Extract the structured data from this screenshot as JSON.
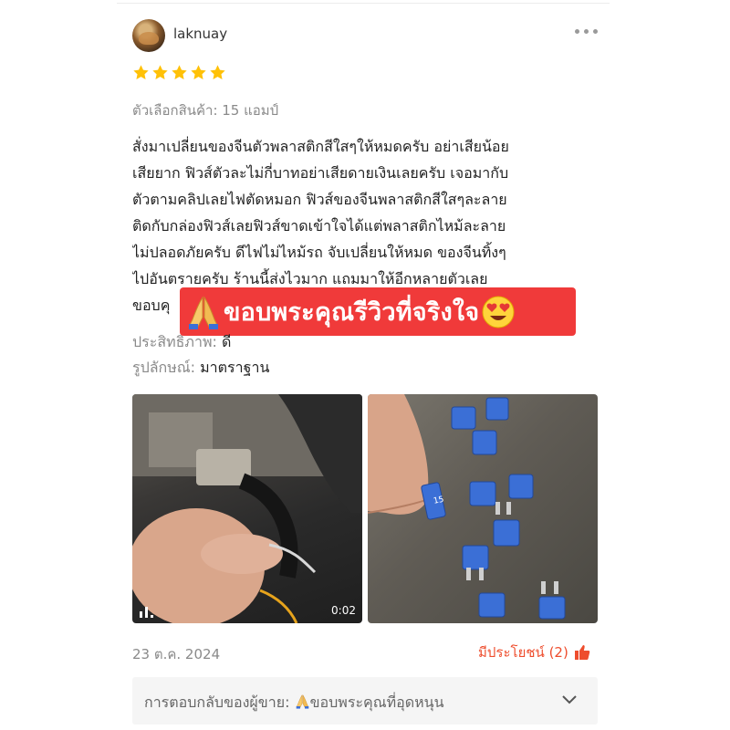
{
  "reviewer": {
    "username": "laknuay",
    "rating": 5,
    "avatar_icon": "user-avatar"
  },
  "variant": "ตัวเลือกสินค้า: 15 แอมป์",
  "review_lines": [
    "สั่งมาเปลี่ยนของจีนตัวพลาสติกสีใสๆให้หมดครับ อย่าเสียน้อย",
    "เสียยาก ฟิวส์ตัวละไม่กี่บาทอย่าเสียดายเงินเลยครับ เจอมากับ",
    "ตัวตามคลิปเลยไฟตัดหมอก ฟิวส์ของจีนพลาสติกสีใสๆละลาย",
    "ติดกับกล่องฟิวส์เลยฟิวส์ขาดเข้าใจได้แต่พลาสติกไหม้ละลาย",
    "ไม่ปลอดภัยครับ ดีไฟไม่ไหม้รถ จับเปลี่ยนให้หมด ของจีนทิ้งๆ",
    "ไปอันตรายครับ ร้านนี้ส่งไวมาก แถมมาให้อีกหลายตัวเลย",
    "ขอบคุ"
  ],
  "sticker": {
    "text": "ขอบพระคุณรีวิวที่จริงใจ",
    "background": "#f03a3a",
    "left_icon": "praying-hands",
    "right_icon": "heart-eyes"
  },
  "attributes": [
    {
      "label": "ประสิทธิภาพ:",
      "value": "ดี"
    },
    {
      "label": "รูปลักษณ์:",
      "value": "มาตราฐาน"
    }
  ],
  "media": {
    "video": {
      "duration": "0:02",
      "icon": "video-icon"
    },
    "photo": {
      "label": "15"
    }
  },
  "date": "23 ต.ค. 2024",
  "helpful": {
    "label": "มีประโยชน์ (2)",
    "icon": "thumbs-up",
    "color": "#ee4d2d"
  },
  "seller_reply": {
    "label": "การตอบกลับของผู้ขาย:",
    "text": "ขอบพระคุณที่อุดหนุน",
    "icon": "praying-hands"
  },
  "colors": {
    "star": "#ffc107",
    "accent": "#ee4d2d",
    "muted": "#8a8a8a"
  }
}
